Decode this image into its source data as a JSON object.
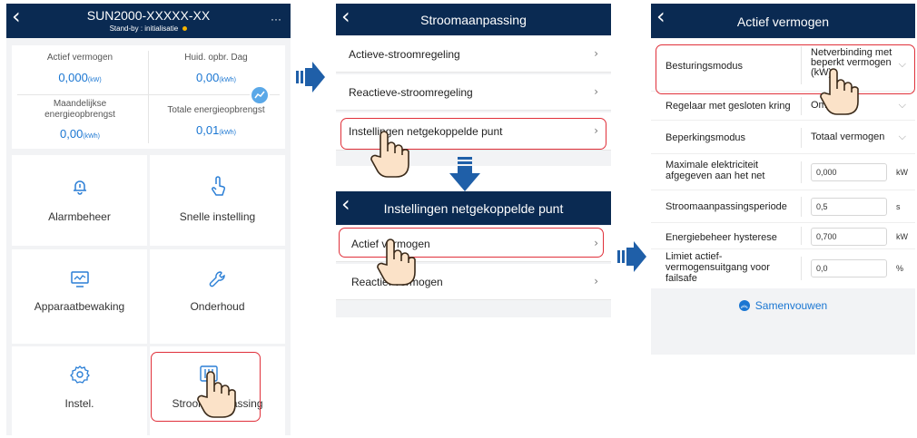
{
  "screen1": {
    "title": "SUN2000-XXXXX-XX",
    "subtitle": "Stand-by : initialisatie",
    "status_dot_color": "#f5b400",
    "nav_more": "···",
    "stats": [
      {
        "label": "Actief vermogen",
        "value": "0,000",
        "unit": "(kW)"
      },
      {
        "label": "Huid. opbr. Dag",
        "value": "0,00",
        "unit": "(kWh)"
      },
      {
        "label": "Maandelijkse energieopbrengst",
        "value": "0,00",
        "unit": "(kWh)"
      },
      {
        "label": "Totale energieopbrengst",
        "value": "0,01",
        "unit": "(kWh)"
      }
    ],
    "tiles": [
      {
        "label": "Alarmbeheer",
        "icon": "bell-icon"
      },
      {
        "label": "Snelle instelling",
        "icon": "tap-icon"
      },
      {
        "label": "Apparaatbewaking",
        "icon": "monitor-icon"
      },
      {
        "label": "Onderhoud",
        "icon": "wrench-icon"
      },
      {
        "label": "Instel.",
        "icon": "gear-icon"
      },
      {
        "label": "Stroomaanpassing",
        "icon": "adjust-icon"
      }
    ]
  },
  "screen2": {
    "title": "Stroomaanpassing",
    "rows": [
      {
        "label": "Actieve-stroomregeling"
      },
      {
        "label": "Reactieve-stroomregeling"
      },
      {
        "label": "Instellingen netgekoppelde punt"
      }
    ]
  },
  "screen2b": {
    "title": "Instellingen netgekoppelde punt",
    "rows": [
      {
        "label": "Actief vermogen"
      },
      {
        "label": "Reactief vermogen"
      }
    ]
  },
  "screen3": {
    "title": "Actief vermogen",
    "rows": [
      {
        "label": "Besturingsmodus",
        "value": "Netverbinding met beperkt vermogen (kW)"
      },
      {
        "label": "Regelaar met gesloten kring",
        "value": "Omvormer"
      },
      {
        "label": "Beperkingsmodus",
        "value": "Totaal vermogen"
      },
      {
        "label": "Maximale elektriciteit afgegeven aan het net",
        "value": "0,000",
        "unit": "kW"
      },
      {
        "label": "Stroomaanpassingsperiode",
        "value": "0,5",
        "unit": "s"
      },
      {
        "label": "Energiebeheer hysterese",
        "value": "0,700",
        "unit": "kW"
      },
      {
        "label": "Limiet actief-vermogensuitgang voor failsafe",
        "value": "0,0",
        "unit": "%"
      }
    ],
    "collapse_label": "Samenvouwen"
  },
  "colors": {
    "navbar": "#0a2a52",
    "accent_blue": "#1a76d2",
    "highlight_red": "#e0303a",
    "flow_arrow": "#1f5fa8"
  }
}
